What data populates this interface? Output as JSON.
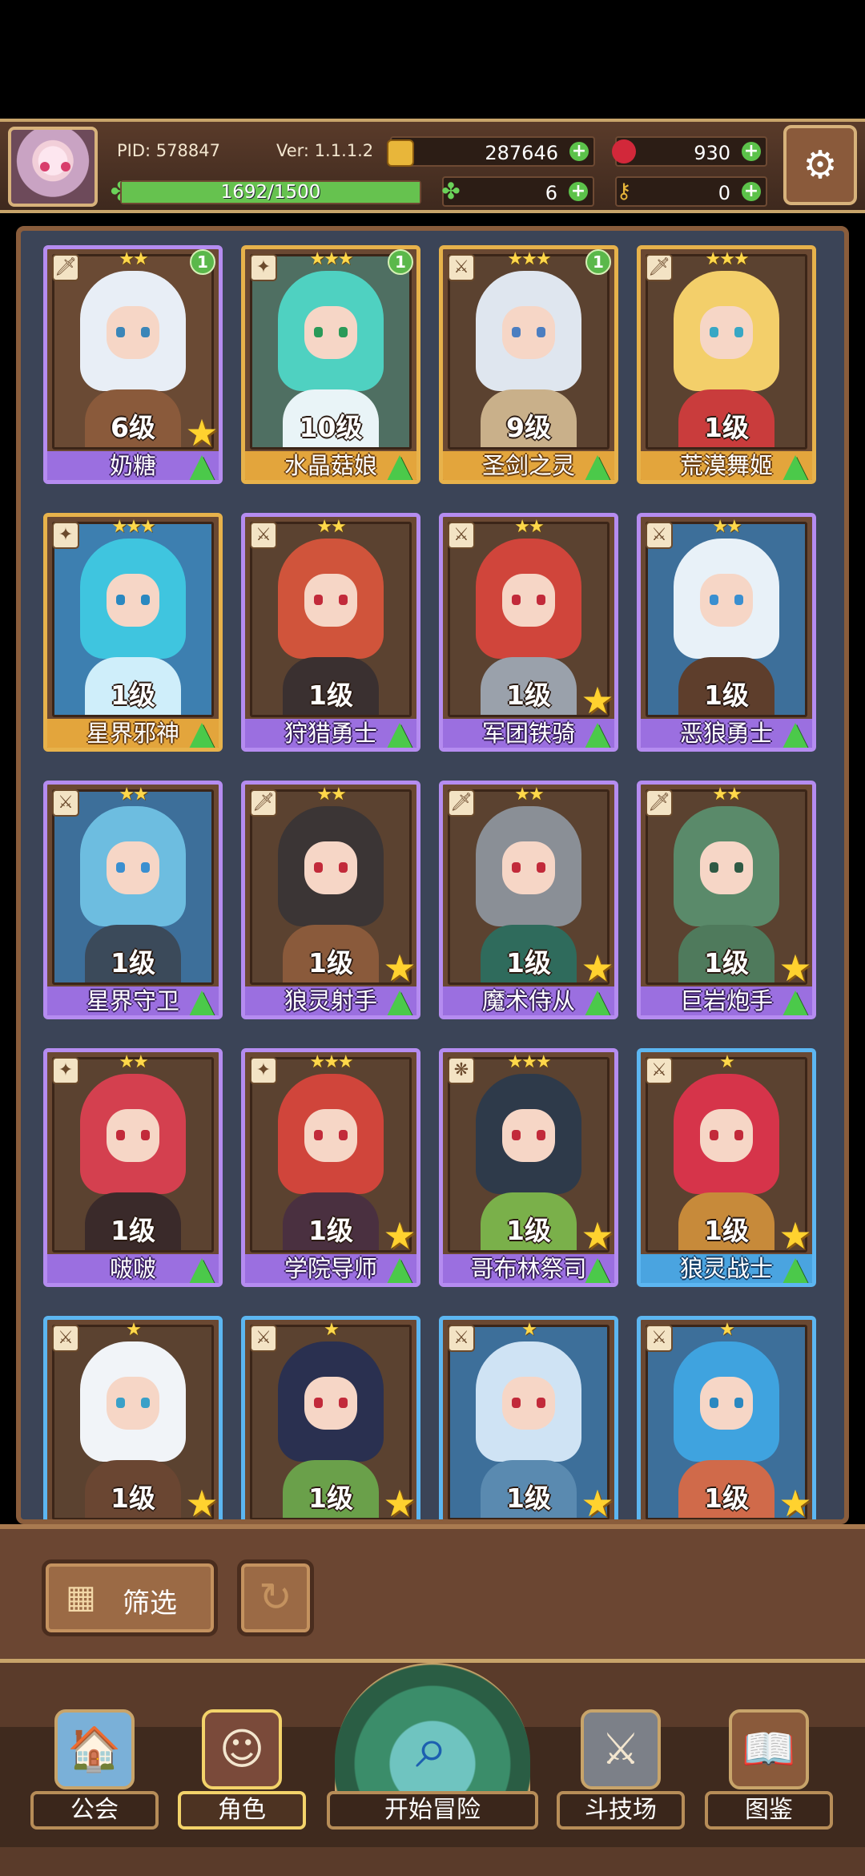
{
  "header": {
    "pid": "PID: 578847",
    "version": "Ver: 1.1.1.2",
    "gold": "287646",
    "gems": "930",
    "xp": "1692/1500",
    "xp_progress": 1.0,
    "clover": "6",
    "keys": "0",
    "icons": {
      "gold": "gold-coin-icon",
      "gems": "red-gem-icon",
      "clover": "clover-icon",
      "keys": "key-icon",
      "settings": "gear-icon",
      "plus": "plus-icon"
    }
  },
  "cards": [
    {
      "name": "奶糖",
      "level": "6级",
      "stars": "★★",
      "frame": "purple",
      "cls": "🗡",
      "badge": "1",
      "upgrade": true,
      "star_badge": true,
      "hair": "#e8eef6",
      "body": "#8a5a3b",
      "eye": "#3b86b8",
      "glow": "#6a4a34"
    },
    {
      "name": "水晶菇娘",
      "level": "10级",
      "stars": "★★★",
      "frame": "gold",
      "cls": "✦",
      "badge": "1",
      "upgrade": true,
      "star_badge": false,
      "hair": "#4fd1c1",
      "body": "#e9f4f7",
      "eye": "#2a9a58",
      "glow": "#4f6f62"
    },
    {
      "name": "圣剑之灵",
      "level": "9级",
      "stars": "★★★",
      "frame": "gold",
      "cls": "⚔",
      "badge": "1",
      "upgrade": true,
      "star_badge": false,
      "hair": "#dfe6ef",
      "body": "#c9b08a",
      "eye": "#4c7ec0",
      "glow": "#5b4230"
    },
    {
      "name": "荒漠舞姬",
      "level": "1级",
      "stars": "★★★",
      "frame": "gold",
      "cls": "🗡",
      "badge": "",
      "upgrade": true,
      "star_badge": false,
      "hair": "#f3cf6a",
      "body": "#c93c3c",
      "eye": "#38a7c4",
      "glow": "#5b4230"
    },
    {
      "name": "星界邪神",
      "level": "1级",
      "stars": "★★★",
      "frame": "gold",
      "cls": "✦",
      "badge": "",
      "upgrade": true,
      "star_badge": false,
      "hair": "#3fc5df",
      "body": "#cfeefa",
      "eye": "#2a88c0",
      "glow": "#3d7fb0"
    },
    {
      "name": "狩猎勇士",
      "level": "1级",
      "stars": "★★",
      "frame": "purple",
      "cls": "⚔",
      "badge": "",
      "upgrade": true,
      "star_badge": false,
      "hair": "#d0543b",
      "body": "#3a3030",
      "eye": "#c22a3a",
      "glow": "#5b4230"
    },
    {
      "name": "军团铁骑",
      "level": "1级",
      "stars": "★★",
      "frame": "purple",
      "cls": "⚔",
      "badge": "",
      "upgrade": true,
      "star_badge": true,
      "hair": "#d0453b",
      "body": "#9aa1ab",
      "eye": "#c22a3a",
      "glow": "#5b4230"
    },
    {
      "name": "恶狼勇士",
      "level": "1级",
      "stars": "★★",
      "frame": "purple",
      "cls": "⚔",
      "badge": "",
      "upgrade": true,
      "star_badge": false,
      "hair": "#e8f1f8",
      "body": "#5e3e2c",
      "eye": "#3a8fd0",
      "glow": "#3d6f9a"
    },
    {
      "name": "星界守卫",
      "level": "1级",
      "stars": "★★",
      "frame": "purple",
      "cls": "⚔",
      "badge": "",
      "upgrade": true,
      "star_badge": false,
      "hair": "#6dbde0",
      "body": "#3b4a5a",
      "eye": "#3a8fd0",
      "glow": "#3d6f9a"
    },
    {
      "name": "狼灵射手",
      "level": "1级",
      "stars": "★★",
      "frame": "purple",
      "cls": "🗡",
      "badge": "",
      "upgrade": true,
      "star_badge": true,
      "hair": "#3b3535",
      "body": "#8a5a3b",
      "eye": "#c22a3a",
      "glow": "#5b4230"
    },
    {
      "name": "魔术侍从",
      "level": "1级",
      "stars": "★★",
      "frame": "purple",
      "cls": "🗡",
      "badge": "",
      "upgrade": true,
      "star_badge": true,
      "hair": "#8a8f96",
      "body": "#2f6b5c",
      "eye": "#c22a3a",
      "glow": "#5b4230"
    },
    {
      "name": "巨岩炮手",
      "level": "1级",
      "stars": "★★",
      "frame": "purple",
      "cls": "🗡",
      "badge": "",
      "upgrade": true,
      "star_badge": true,
      "hair": "#5a8a6a",
      "body": "#4f7a5c",
      "eye": "#2f5a44",
      "glow": "#5b4230"
    },
    {
      "name": "啵啵",
      "level": "1级",
      "stars": "★★",
      "frame": "purple",
      "cls": "✦",
      "badge": "",
      "upgrade": true,
      "star_badge": false,
      "hair": "#d4404f",
      "body": "#3a2a2a",
      "eye": "#c22a3a",
      "glow": "#5b4230"
    },
    {
      "name": "学院导师",
      "level": "1级",
      "stars": "★★★",
      "frame": "purple",
      "cls": "✦",
      "badge": "",
      "upgrade": true,
      "star_badge": true,
      "hair": "#d0453b",
      "body": "#4a3040",
      "eye": "#c22a3a",
      "glow": "#5b4230"
    },
    {
      "name": "哥布林祭司",
      "level": "1级",
      "stars": "★★★",
      "frame": "purple",
      "cls": "❋",
      "badge": "",
      "upgrade": true,
      "star_badge": true,
      "hair": "#2e3a4a",
      "body": "#7ab04a",
      "eye": "#c22a3a",
      "glow": "#5b4230"
    },
    {
      "name": "狼灵战士",
      "level": "1级",
      "stars": "★",
      "frame": "blue",
      "cls": "⚔",
      "badge": "",
      "upgrade": true,
      "star_badge": true,
      "hair": "#d6344a",
      "body": "#c78a3a",
      "eye": "#c22a3a",
      "glow": "#5b4230"
    },
    {
      "name": "",
      "level": "1级",
      "stars": "★",
      "frame": "blue",
      "cls": "⚔",
      "badge": "",
      "upgrade": false,
      "star_badge": true,
      "hair": "#f1f4f8",
      "body": "#6a4632",
      "eye": "#3aa0c8",
      "glow": "#5b4230"
    },
    {
      "name": "",
      "level": "1级",
      "stars": "★",
      "frame": "blue",
      "cls": "⚔",
      "badge": "",
      "upgrade": false,
      "star_badge": true,
      "hair": "#2a3050",
      "body": "#6aa04a",
      "eye": "#c22a3a",
      "glow": "#5b4230"
    },
    {
      "name": "",
      "level": "1级",
      "stars": "★",
      "frame": "blue",
      "cls": "⚔",
      "badge": "",
      "upgrade": false,
      "star_badge": true,
      "hair": "#cfe3f4",
      "body": "#5a8ab0",
      "eye": "#c22a3a",
      "glow": "#3d6f9a"
    },
    {
      "name": "",
      "level": "1级",
      "stars": "★",
      "frame": "blue",
      "cls": "⚔",
      "badge": "",
      "upgrade": false,
      "star_badge": true,
      "hair": "#3fa3df",
      "body": "#d06a4a",
      "eye": "#2a88c0",
      "glow": "#3d6f9a"
    }
  ],
  "filter": {
    "filter_label": "筛选",
    "filter_icon": "grid-icon",
    "refresh_icon": "refresh-icon"
  },
  "nav": {
    "guild": "公会",
    "roles": "角色",
    "adventure": "开始冒险",
    "arena": "斗技场",
    "codex": "图鉴",
    "icons": [
      "house-icon",
      "character-icon",
      "magnifier-map-icon",
      "crossed-swords-icon",
      "book-icon"
    ]
  }
}
